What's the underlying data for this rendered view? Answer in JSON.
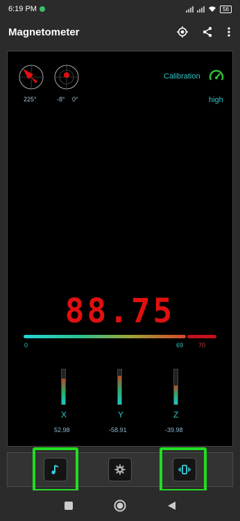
{
  "status": {
    "time": "6:19 PM",
    "battery": "56"
  },
  "app": {
    "title": "Magnetometer"
  },
  "orientation": {
    "compass_angle": "225°",
    "tilt_x": "-8°",
    "tilt_y": "0°"
  },
  "calibration": {
    "label": "Calibration",
    "value": "high"
  },
  "reading": {
    "value": "88.75"
  },
  "range_bar": {
    "min": "0",
    "current": "69",
    "max": "70",
    "fraction": 0.86
  },
  "axes": [
    {
      "label": "X",
      "value": "52.98",
      "level": 0.75
    },
    {
      "label": "Y",
      "value": "-58.91",
      "level": 0.82
    },
    {
      "label": "Z",
      "value": "-39.98",
      "level": 0.55
    }
  ],
  "colors": {
    "accent": "#2fc6c6",
    "reading": "#e01010",
    "highlight": "#22dd22",
    "background": "#000000"
  },
  "icons": [
    "target-icon",
    "share-icon",
    "more-vert-icon",
    "speedometer-icon",
    "music-note-icon",
    "gear-icon",
    "vibrate-icon"
  ]
}
